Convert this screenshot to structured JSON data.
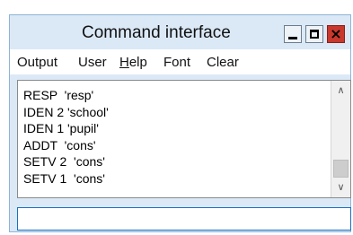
{
  "window": {
    "title": "Command interface",
    "controls": {
      "minimize": "minimize-icon",
      "maximize": "maximize-icon",
      "close_glyph": "×"
    }
  },
  "menubar": {
    "items": [
      {
        "label_pre": "Output",
        "label_u": "",
        "label_post": ""
      },
      {
        "label_pre": "User",
        "label_u": "",
        "label_post": ""
      },
      {
        "label_pre": "",
        "label_u": "H",
        "label_post": "elp"
      },
      {
        "label_pre": "Font",
        "label_u": "",
        "label_post": ""
      },
      {
        "label_pre": "Clear",
        "label_u": "",
        "label_post": ""
      }
    ]
  },
  "output": {
    "lines": [
      "RESP  'resp'",
      "IDEN 2 'school'",
      "IDEN 1 'pupil'",
      "ADDT  'cons'",
      "SETV 2  'cons'",
      "SETV 1  'cons'"
    ],
    "scroll_up_glyph": "∧",
    "scroll_down_glyph": "∨"
  },
  "command_input": {
    "value": ""
  },
  "colors": {
    "titlebar": "#dbe9f7",
    "close_button": "#c8382d",
    "input_border": "#1a6fc4"
  }
}
